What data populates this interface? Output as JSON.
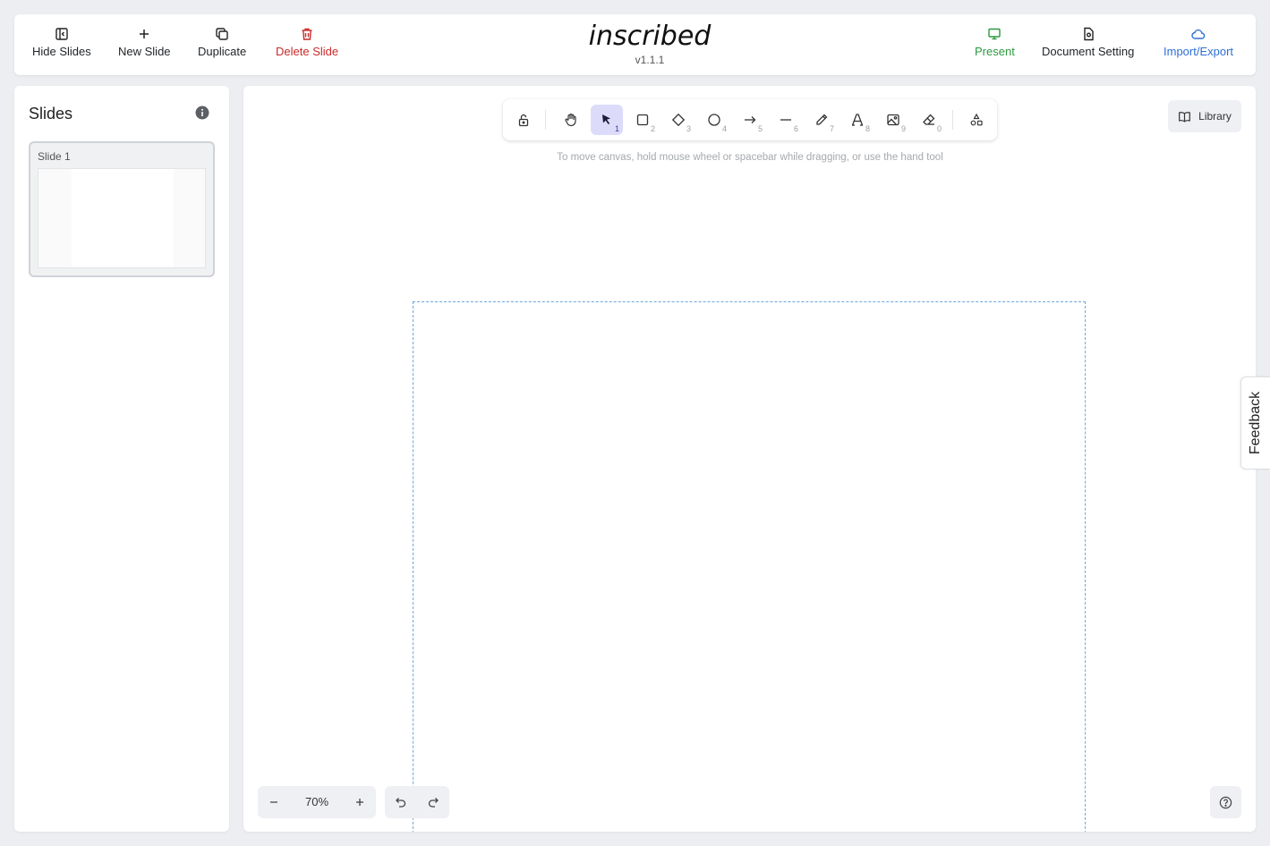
{
  "topbar": {
    "hide_slides": "Hide Slides",
    "new_slide": "New Slide",
    "duplicate": "Duplicate",
    "delete_slide": "Delete Slide",
    "present": "Present",
    "document_setting": "Document Setting",
    "import_export": "Import/Export"
  },
  "brand": {
    "logo": "inscribed",
    "version": "v1.1.1"
  },
  "sidebar": {
    "title": "Slides",
    "slides": [
      {
        "label": "Slide 1"
      }
    ]
  },
  "toolbar": {
    "tools": [
      {
        "name": "lock",
        "key": ""
      },
      {
        "name": "hand",
        "key": ""
      },
      {
        "name": "selection",
        "key": "1"
      },
      {
        "name": "rectangle",
        "key": "2"
      },
      {
        "name": "diamond",
        "key": "3"
      },
      {
        "name": "ellipse",
        "key": "4"
      },
      {
        "name": "arrow",
        "key": "5"
      },
      {
        "name": "line",
        "key": "6"
      },
      {
        "name": "draw",
        "key": "7"
      },
      {
        "name": "text",
        "key": "8"
      },
      {
        "name": "image",
        "key": "9"
      },
      {
        "name": "eraser",
        "key": "0"
      },
      {
        "name": "extra-tools",
        "key": ""
      }
    ],
    "active_tool": "selection"
  },
  "canvas": {
    "hint": "To move canvas, hold mouse wheel or spacebar while dragging, or use the hand tool",
    "library_label": "Library",
    "zoom": "70%"
  },
  "feedback": {
    "label": "Feedback"
  },
  "colors": {
    "delete": "#c92a2a",
    "present": "#2b9a3e",
    "import_export": "#2f6fd6",
    "active_tool_bg": "#dcdcfa",
    "frame_border": "#6aa8df"
  }
}
